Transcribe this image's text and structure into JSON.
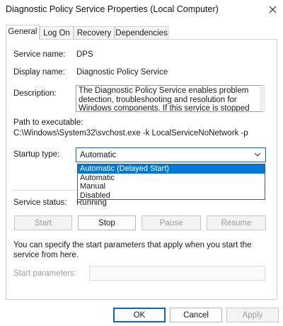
{
  "window": {
    "title": "Diagnostic Policy Service Properties (Local Computer)"
  },
  "tabs": [
    {
      "label": "General"
    },
    {
      "label": "Log On"
    },
    {
      "label": "Recovery"
    },
    {
      "label": "Dependencies"
    }
  ],
  "general": {
    "service_name_label": "Service name:",
    "service_name_value": "DPS",
    "display_name_label": "Display name:",
    "display_name_value": "Diagnostic Policy Service",
    "description_label": "Description:",
    "description_value": "The Diagnostic Policy Service enables problem detection, troubleshooting and resolution for Windows components.  If this service is stopped",
    "path_label": "Path to executable:",
    "path_value": "C:\\Windows\\System32\\svchost.exe -k LocalServiceNoNetwork -p",
    "startup_type_label": "Startup type:",
    "startup_type_value": "Automatic",
    "startup_options": [
      "Automatic (Delayed Start)",
      "Automatic",
      "Manual",
      "Disabled"
    ],
    "service_status_label": "Service status:",
    "service_status_value": "Running",
    "buttons": {
      "start": "Start",
      "stop": "Stop",
      "pause": "Pause",
      "resume": "Resume"
    },
    "hint": "You can specify the start parameters that apply when you start the service from here.",
    "start_params_label": "Start parameters:"
  },
  "footer": {
    "ok": "OK",
    "cancel": "Cancel",
    "apply": "Apply"
  },
  "colors": {
    "accent": "#0078d7",
    "focus_border": "#0a66c2"
  }
}
